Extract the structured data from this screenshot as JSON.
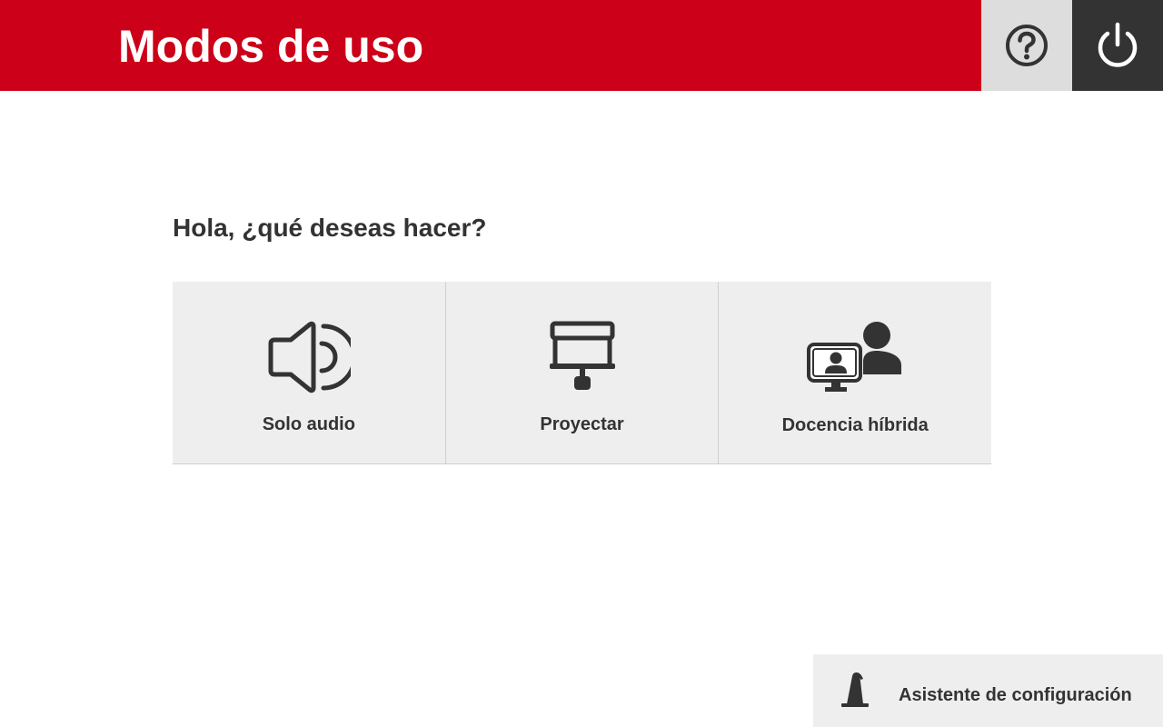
{
  "header": {
    "title": "Modos de uso",
    "brand_color": "#cc0018",
    "help_icon": "question-circle-icon",
    "power_icon": "power-icon"
  },
  "main": {
    "greeting": "Hola, ¿qué deseas hacer?",
    "modes": [
      {
        "label": "Solo audio",
        "icon": "speaker-icon"
      },
      {
        "label": "Proyectar",
        "icon": "projector-screen-icon"
      },
      {
        "label": "Docencia híbrida",
        "icon": "hybrid-teaching-icon"
      }
    ]
  },
  "footer": {
    "wizard_label": "Asistente de configuración",
    "wizard_icon": "wizard-hat-icon"
  }
}
